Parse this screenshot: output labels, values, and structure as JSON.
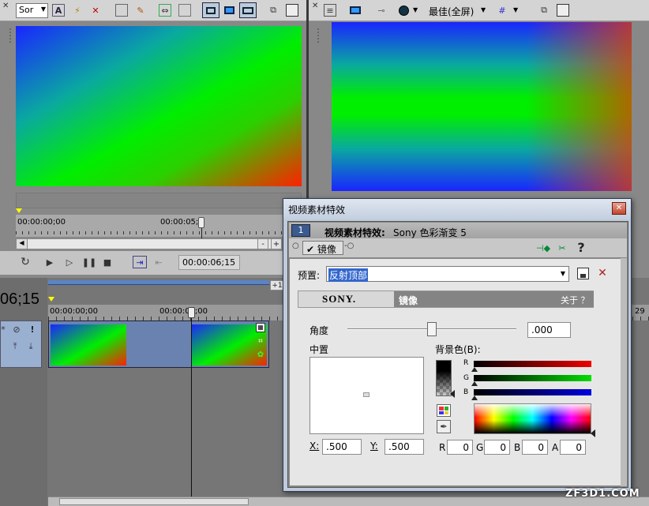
{
  "left_toolbar": {
    "preview_mode": "Sor"
  },
  "right_toolbar": {
    "quality": "最佳(全屏)"
  },
  "trimmer": {
    "ruler_start": "00:00:00;00",
    "ruler_mark": "00:00:05;",
    "time_display": "00:00:06;15"
  },
  "timeline": {
    "current_time": "06;15",
    "ruler_start": "00:00:00;00",
    "ruler_mark": "00:00:05;00",
    "add_label": "+1",
    "right_edge_label": "29"
  },
  "dialog": {
    "title": "视频素材特效",
    "track_number": "1",
    "chain_label": "视频素材特效:",
    "chain_value": "Sony 色彩渐变 5",
    "chain_tab": "镜像",
    "preset_label": "预置:",
    "preset_value": "反射顶部",
    "brand": "SONY.",
    "plugin_name": "镜像",
    "about": "关于 ？",
    "angle_label": "角度",
    "angle_value": ".000",
    "angle_fraction": 0.5,
    "center_label": "中置",
    "bg_color_label": "背景色(B):",
    "x_label": "X:",
    "x_value": ".500",
    "y_label": "Y:",
    "y_value": ".500",
    "channels": {
      "r": "R",
      "g": "G",
      "b": "B"
    },
    "rgba": [
      {
        "label": "R",
        "value": "0"
      },
      {
        "label": "G",
        "value": "0"
      },
      {
        "label": "B",
        "value": "0"
      },
      {
        "label": "A",
        "value": "0"
      }
    ]
  },
  "watermark": {
    "text": "ZF3D1.COM"
  }
}
